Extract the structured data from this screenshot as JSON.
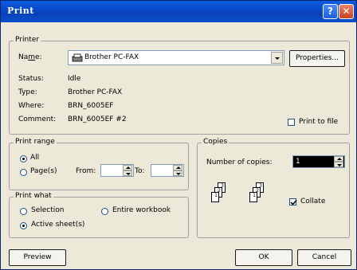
{
  "window": {
    "title": "Print",
    "help_label": "?",
    "close_label": "✕"
  },
  "printer": {
    "group_label": "Printer",
    "name_label": "Name:",
    "name_value": "Brother PC-FAX",
    "properties_label": "Properties...",
    "status_label": "Status:",
    "status_value": "Idle",
    "type_label": "Type:",
    "type_value": "Brother PC-FAX",
    "where_label": "Where:",
    "where_value": "BRN_6005EF",
    "comment_label": "Comment:",
    "comment_value": "BRN_6005EF #2",
    "print_to_file_label": "Print to file",
    "print_to_file_checked": false,
    "printer_icon": "printer-icon"
  },
  "print_range": {
    "group_label": "Print range",
    "all_label": "All",
    "pages_label": "Page(s)",
    "from_label": "From:",
    "to_label": "To:",
    "from_value": "",
    "to_value": "",
    "selected": "All"
  },
  "copies": {
    "group_label": "Copies",
    "number_label": "Number of copies:",
    "number_value": "1",
    "collate_label": "Collate",
    "collate_checked": true,
    "collate_icon": "collate-pages-icon"
  },
  "print_what": {
    "group_label": "Print what",
    "selection_label": "Selection",
    "entire_workbook_label": "Entire workbook",
    "active_sheets_label": "Active sheet(s)",
    "selected": "Active sheet(s)"
  },
  "buttons": {
    "preview": "Preview",
    "ok": "OK",
    "cancel": "Cancel"
  }
}
